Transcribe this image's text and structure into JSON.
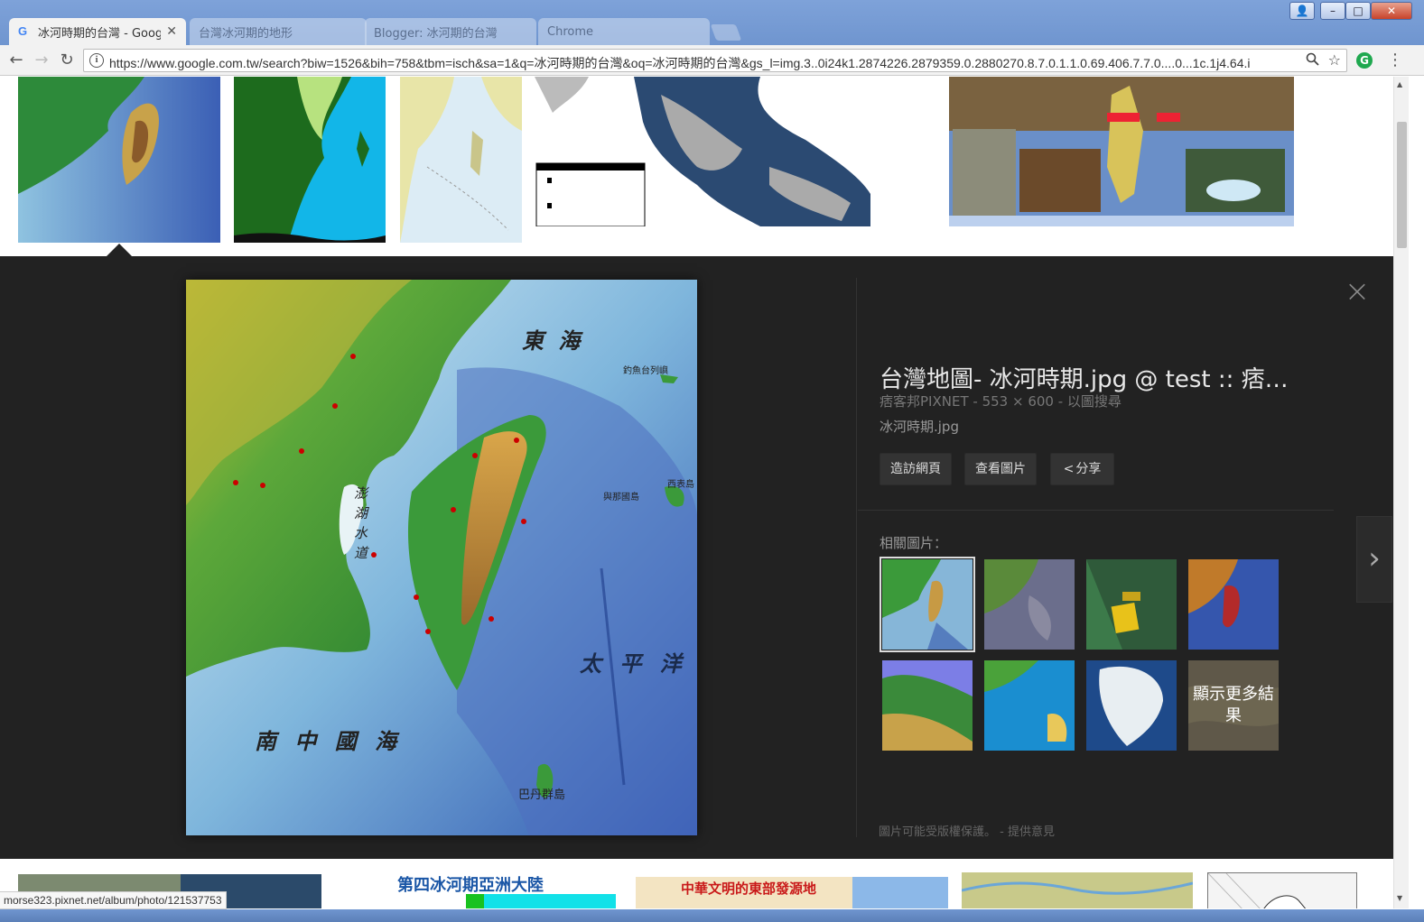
{
  "browser": {
    "active_tab": {
      "title": "冰河時期的台灣 - Googl",
      "favicon": "G"
    },
    "bg_tabs": [
      {
        "title": "台灣冰河期的地形"
      },
      {
        "title": "Blogger: 冰河期的台灣"
      },
      {
        "title": "Chrome"
      }
    ],
    "window_controls": {
      "minimize": "–",
      "maximize": "□",
      "close": "✕",
      "user": "👤"
    },
    "url": "https://www.google.com.tw/search?biw=1526&bih=758&tbm=isch&sa=1&q=冰河時期的台灣&oq=冰河時期的台灣&gs_l=img.3..0i24k1.2874226.2879359.0.2880270.8.7.0.1.1.0.69.406.7.7.0....0...1c.1j4.64.i",
    "info_icon": "i",
    "zoom_icon": "🔍",
    "star_icon": "☆",
    "ext_icon": "G",
    "menu_icon": "⋮"
  },
  "detail": {
    "title": "台灣地圖- 冰河時期.jpg @ test :: 痞客邦 PIXNET ::",
    "source": "痞客邦PIXNET",
    "dimensions": "553 × 600",
    "search_by_image": "以圖搜尋",
    "filename": "冰河時期.jpg",
    "buttons": {
      "visit": "造訪網頁",
      "view": "查看圖片",
      "share": "分享"
    },
    "related_label": "相關圖片：",
    "more_results": "顯示更多結果",
    "footer": "圖片可能受版權保護。 - 提供意見",
    "close_icon": "×",
    "next_icon": "›"
  },
  "map_labels": {
    "east_sea": "東 海",
    "diaoyu": "釣魚台列嶼",
    "yonaguni": "與那國島",
    "iriomote": "西表島",
    "taiwan_strait": "澎湖水道",
    "pacific": "太 平 洋",
    "south_china_sea": "南 中 國 海",
    "batanes": "巴丹群島"
  },
  "bottom_row": {
    "ice_age_asia": "第四冰河期亞洲大陸",
    "eastern_origin": "中華文明的東部發源地"
  },
  "status_url": "morse323.pixnet.net/album/photo/121537753"
}
